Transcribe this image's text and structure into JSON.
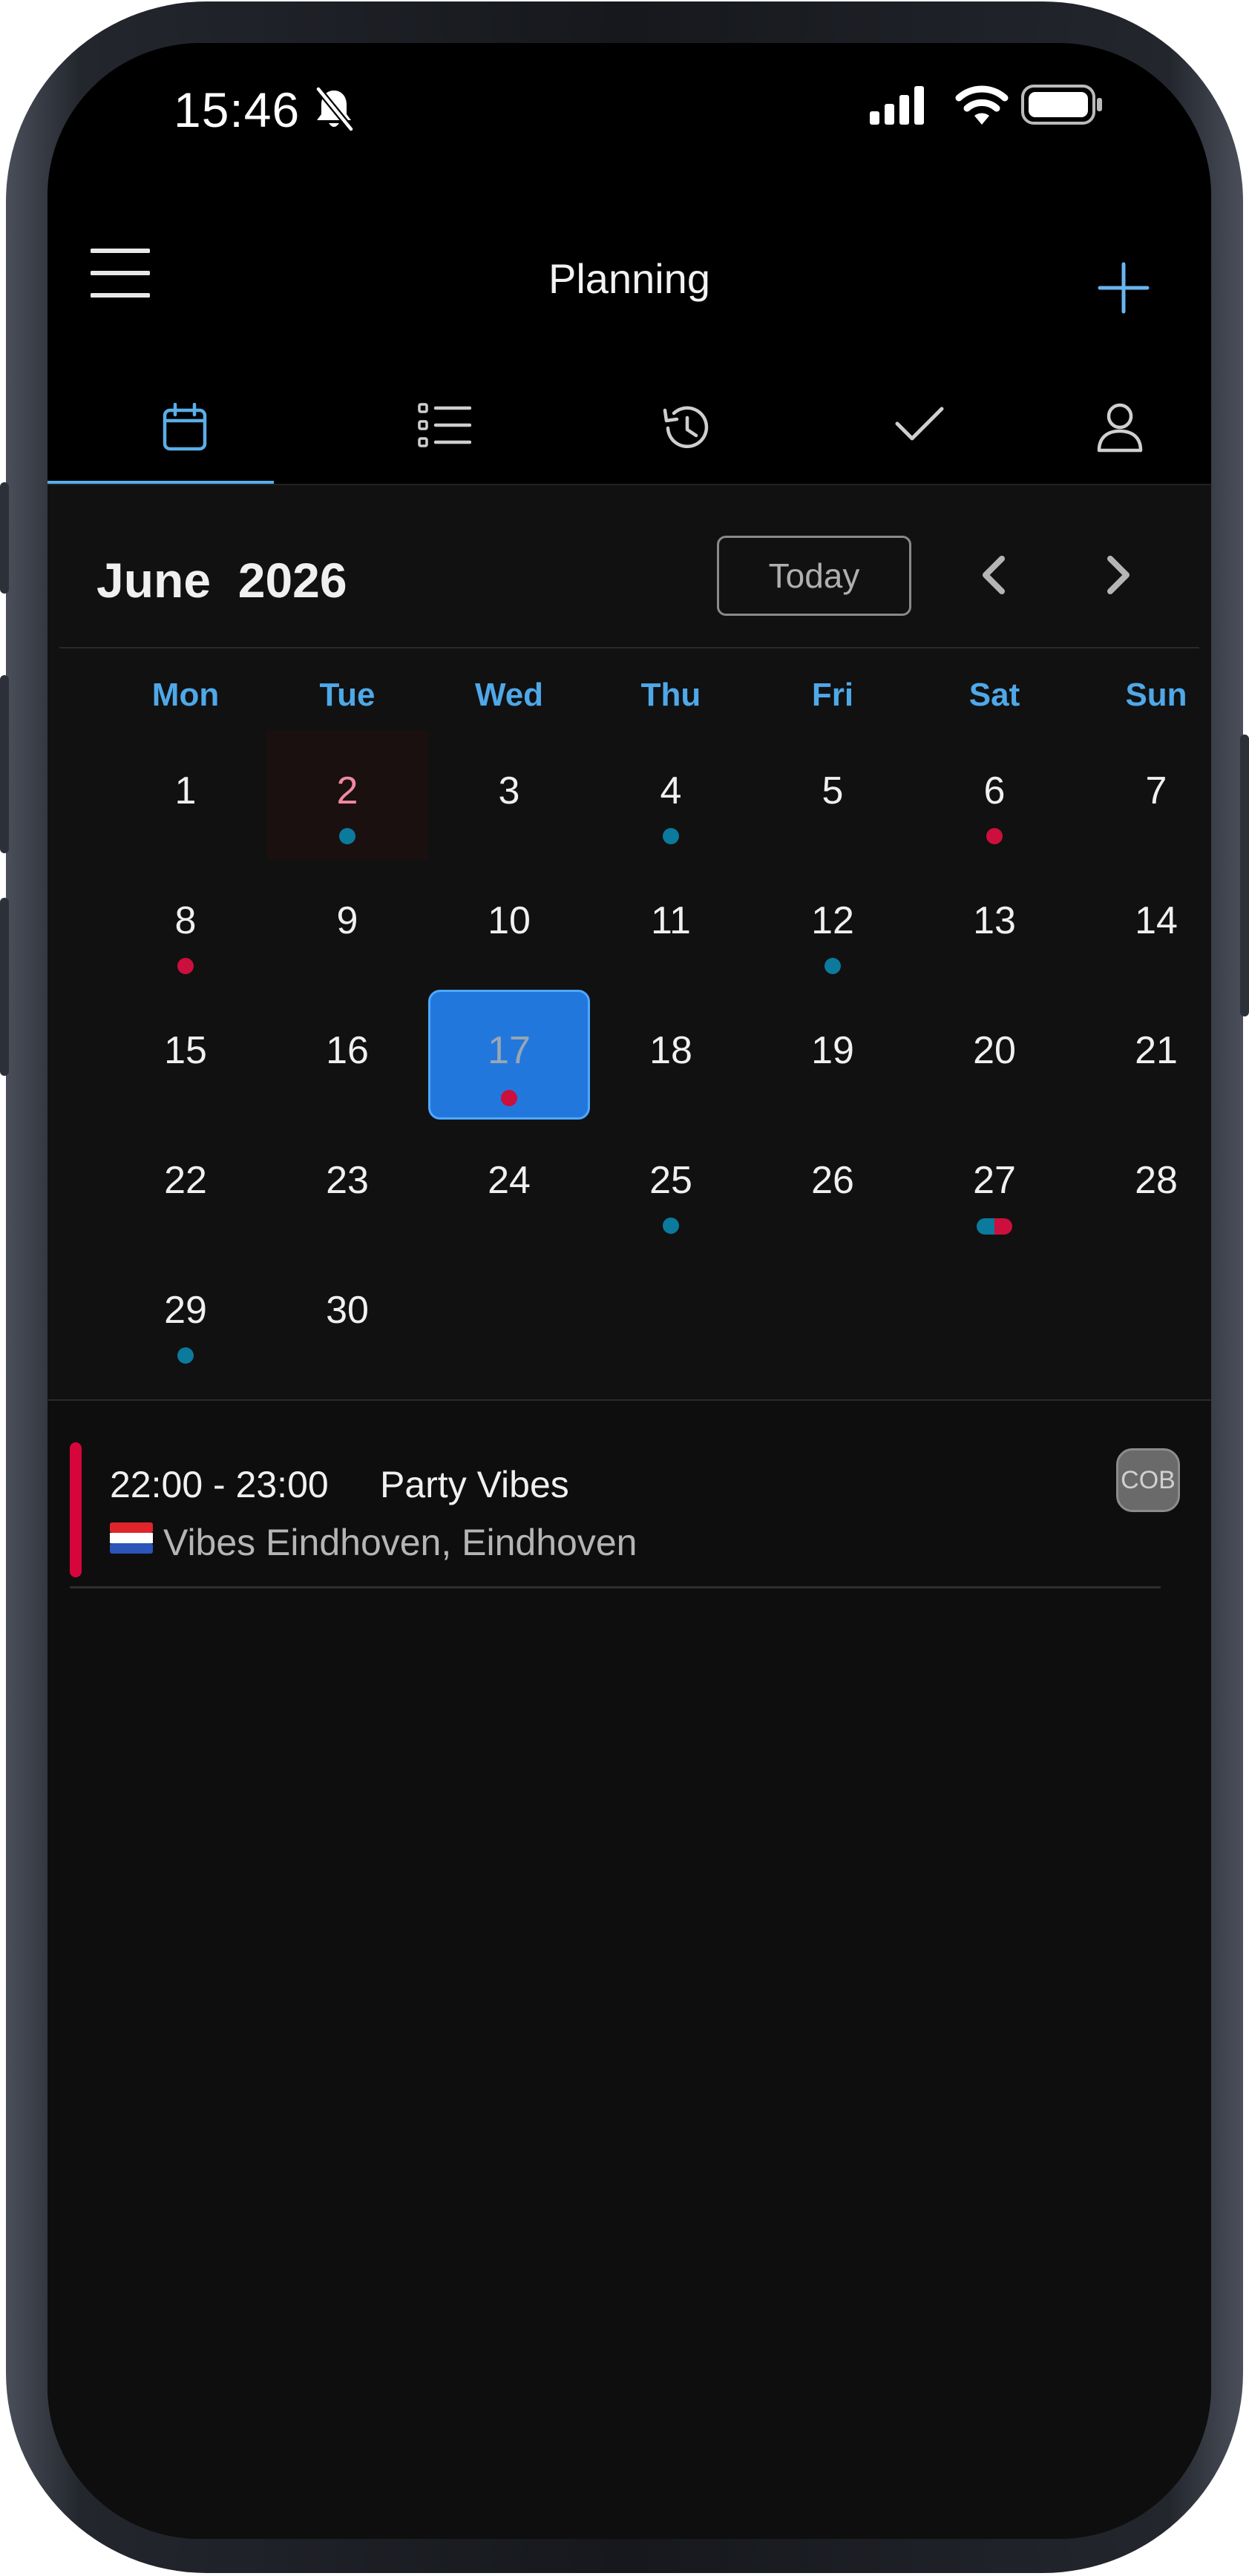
{
  "status_bar": {
    "time": "15:46"
  },
  "header": {
    "title": "Planning"
  },
  "tabs": [
    {
      "id": "calendar",
      "icon": "calendar-icon",
      "active": true
    },
    {
      "id": "list",
      "icon": "list-icon",
      "active": false
    },
    {
      "id": "history",
      "icon": "history-icon",
      "active": false
    },
    {
      "id": "done",
      "icon": "checkmark-icon",
      "active": false
    },
    {
      "id": "profile",
      "icon": "person-icon",
      "active": false
    }
  ],
  "calendar": {
    "month": "June",
    "year": "2026",
    "today_label": "Today",
    "weekdays": [
      "Mon",
      "Tue",
      "Wed",
      "Thu",
      "Fri",
      "Sat",
      "Sun"
    ],
    "highlighted_day": "2",
    "selected_day": "17",
    "days": [
      {
        "day": "1",
        "dots": []
      },
      {
        "day": "2",
        "dots": [
          "teal"
        ]
      },
      {
        "day": "3",
        "dots": []
      },
      {
        "day": "4",
        "dots": [
          "teal"
        ]
      },
      {
        "day": "5",
        "dots": []
      },
      {
        "day": "6",
        "dots": [
          "red"
        ]
      },
      {
        "day": "7",
        "dots": []
      },
      {
        "day": "8",
        "dots": [
          "red"
        ]
      },
      {
        "day": "9",
        "dots": []
      },
      {
        "day": "10",
        "dots": []
      },
      {
        "day": "11",
        "dots": []
      },
      {
        "day": "12",
        "dots": [
          "teal"
        ]
      },
      {
        "day": "13",
        "dots": []
      },
      {
        "day": "14",
        "dots": []
      },
      {
        "day": "15",
        "dots": []
      },
      {
        "day": "16",
        "dots": []
      },
      {
        "day": "17",
        "dots": [
          "red"
        ]
      },
      {
        "day": "18",
        "dots": []
      },
      {
        "day": "19",
        "dots": []
      },
      {
        "day": "20",
        "dots": []
      },
      {
        "day": "21",
        "dots": []
      },
      {
        "day": "22",
        "dots": []
      },
      {
        "day": "23",
        "dots": []
      },
      {
        "day": "24",
        "dots": []
      },
      {
        "day": "25",
        "dots": [
          "teal"
        ]
      },
      {
        "day": "26",
        "dots": []
      },
      {
        "day": "27",
        "dots": [
          "teal",
          "red"
        ]
      },
      {
        "day": "28",
        "dots": []
      },
      {
        "day": "29",
        "dots": [
          "teal"
        ]
      },
      {
        "day": "30",
        "dots": []
      }
    ]
  },
  "events": [
    {
      "time": "22:00 - 23:00",
      "title": "Party Vibes",
      "location": "Vibes Eindhoven, Eindhoven",
      "flag": "netherlands-flag",
      "badge": "COB",
      "color": "#d6063c"
    }
  ],
  "colors": {
    "accent": "#4fa8e8",
    "selected": "#2277dd",
    "dot_teal": "#0b7a9c",
    "dot_red": "#cc0f3c"
  }
}
